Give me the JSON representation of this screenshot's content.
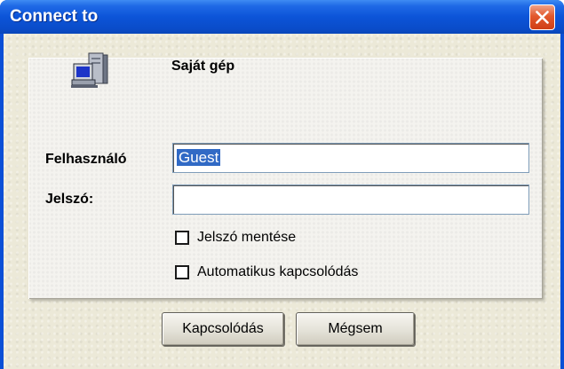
{
  "window": {
    "title": "Connect to"
  },
  "site": {
    "name": "Saját gép"
  },
  "form": {
    "username_label": "Felhasználó",
    "username_value": "Guest",
    "password_label": "Jelszó:",
    "password_value": ""
  },
  "options": {
    "save_password": {
      "label": "Jelszó mentése",
      "checked": false
    },
    "auto_connect": {
      "label": "Automatikus kapcsolódás",
      "checked": false
    }
  },
  "buttons": {
    "connect": "Kapcsolódás",
    "cancel": "Mégsem"
  },
  "colors": {
    "titlebar": "#0a4fd6",
    "close": "#e2582c",
    "selection": "#316ac5",
    "dialog": "#ece9d8"
  }
}
